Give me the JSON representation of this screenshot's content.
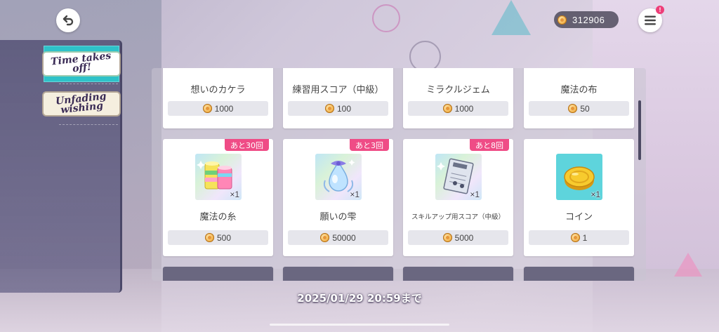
{
  "header": {
    "currency_amount": "312906",
    "menu_badge": "!"
  },
  "sidebar": {
    "items": [
      {
        "label": "Time takes off!",
        "active": true
      },
      {
        "label": "Unfading wishing",
        "active": false
      }
    ]
  },
  "shop": {
    "top_row": [
      {
        "name": "想いのカケラ",
        "price": "1000"
      },
      {
        "name": "練習用スコア（中級）",
        "price": "100"
      },
      {
        "name": "ミラクルジェム",
        "price": "1000"
      },
      {
        "name": "魔法の布",
        "price": "50"
      }
    ],
    "items": [
      {
        "name": "魔法の糸",
        "price": "500",
        "remaining": "あと30回",
        "quantity": "×1",
        "icon": "thread-spools-icon"
      },
      {
        "name": "願いの雫",
        "price": "50000",
        "remaining": "あと3回",
        "quantity": "×1",
        "icon": "wish-droplet-icon"
      },
      {
        "name": "スキルアップ用スコア（中級）",
        "price": "5000",
        "remaining": "あと8回",
        "quantity": "×1",
        "icon": "skill-score-icon"
      },
      {
        "name": "コイン",
        "price": "1",
        "remaining": "",
        "quantity": "×1",
        "icon": "coin-icon"
      }
    ]
  },
  "footer": {
    "deadline": "2025/01/29 20:59まで"
  },
  "colors": {
    "accent_teal": "#2ec2c9",
    "badge_pink": "#ef4c86"
  }
}
